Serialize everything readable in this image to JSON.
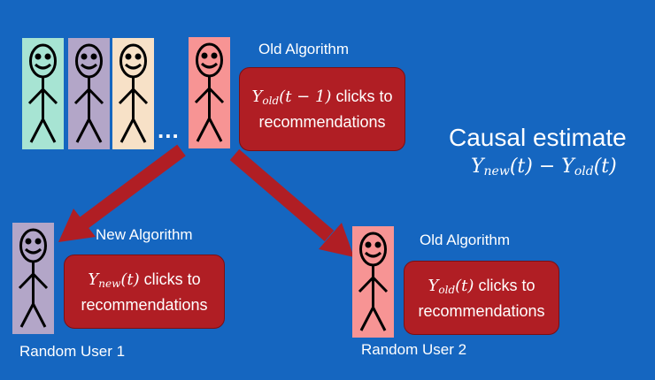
{
  "colors": {
    "background": "#1566c0",
    "box": "#b01e24",
    "arrow": "#b01e24",
    "person_teal": "#a7e4d3",
    "person_purple": "#b3a6c8",
    "person_peach": "#f7e1c7",
    "person_pink": "#f79494"
  },
  "top_group": {
    "ellipsis": "...",
    "old_label": "Old Algorithm",
    "box_suffix": "clicks to",
    "box_line2": "recommendations",
    "formula": {
      "var": "Y",
      "sub": "old",
      "arg": "(t − 1)"
    }
  },
  "causal": {
    "title": "Causal estimate",
    "formula": {
      "y1": "Y",
      "sub1": "new",
      "arg1": "(t)",
      "op": "−",
      "y2": "Y",
      "sub2": "old",
      "arg2": "(t)"
    }
  },
  "left_group": {
    "label": "New Algorithm",
    "box_suffix": "clicks to",
    "box_line2": "recommendations",
    "formula": {
      "var": "Y",
      "sub": "new",
      "arg": "(t)"
    },
    "user_label": "Random User 1"
  },
  "right_group": {
    "label": "Old Algorithm",
    "box_suffix": "clicks to",
    "box_line2": "recommendations",
    "formula": {
      "var": "Y",
      "sub": "old",
      "arg": "(t)"
    },
    "user_label": "Random User 2"
  },
  "icons": [
    "stick-figure-icon",
    "arrow-icon"
  ]
}
